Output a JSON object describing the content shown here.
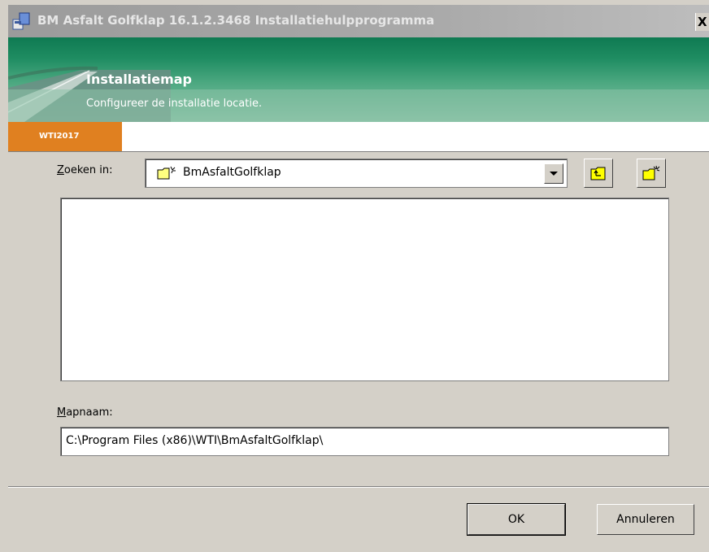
{
  "window": {
    "title": "BM Asfalt Golfklap 16.1.2.3468 Installatiehulpprogramma",
    "close_label": "X"
  },
  "banner": {
    "title": "Installatiemap",
    "subtitle": "Configureer de installatie locatie.",
    "badge": "WTI2017"
  },
  "lookin": {
    "label_first": "Z",
    "label_rest": "oeken in:",
    "value": "BmAsfaltGolfklap"
  },
  "foldername": {
    "label_first": "M",
    "label_rest": "apnaam:",
    "value": "C:\\Program Files (x86)\\WTI\\BmAsfaltGolfklap\\"
  },
  "buttons": {
    "ok": "OK",
    "cancel": "Annuleren"
  },
  "icons": [
    "installer-icon",
    "folder-icon",
    "folder-up-icon",
    "new-folder-icon",
    "dropdown-arrow-icon"
  ]
}
